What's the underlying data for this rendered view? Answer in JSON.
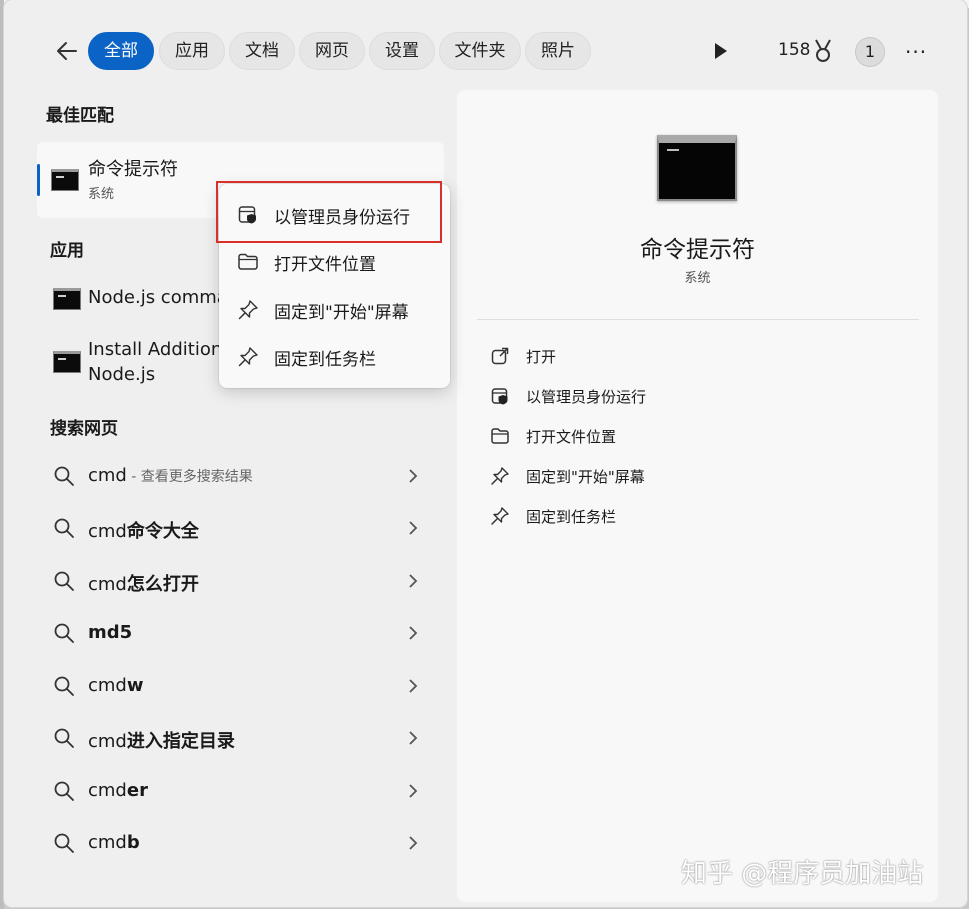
{
  "filters": {
    "back_label": "",
    "chips": [
      {
        "label": "全部",
        "active": true
      },
      {
        "label": "应用",
        "active": false
      },
      {
        "label": "文档",
        "active": false
      },
      {
        "label": "网页",
        "active": false
      },
      {
        "label": "设置",
        "active": false
      },
      {
        "label": "文件夹",
        "active": false
      },
      {
        "label": "照片",
        "active": false
      }
    ],
    "points": "158",
    "avatar_text": "1",
    "more_label": "···"
  },
  "best_match": {
    "section_title": "最佳匹配",
    "name": "命令提示符",
    "subtitle": "系统"
  },
  "apps": {
    "section_title": "应用",
    "items": [
      {
        "label": "Node.js comma"
      },
      {
        "label_line1": "Install Additiona",
        "label_line2": "Node.js"
      }
    ]
  },
  "web_search": {
    "section_title": "搜索网页",
    "items": [
      {
        "prefix": "cmd",
        "bold": "",
        "hint": " - 查看更多搜索结果"
      },
      {
        "prefix": "cmd",
        "bold": "命令大全",
        "hint": ""
      },
      {
        "prefix": "cmd",
        "bold": "怎么打开",
        "hint": ""
      },
      {
        "prefix": "",
        "bold": "md5",
        "hint": ""
      },
      {
        "prefix": "cmd",
        "bold": "w",
        "hint": ""
      },
      {
        "prefix": "cmd",
        "bold": "进入指定目录",
        "hint": ""
      },
      {
        "prefix": "cmd",
        "bold": "er",
        "hint": ""
      },
      {
        "prefix": "cmd",
        "bold": "b",
        "hint": ""
      }
    ]
  },
  "context_menu": {
    "items": [
      {
        "label": "以管理员身份运行",
        "icon": "shield-window-icon"
      },
      {
        "label": "打开文件位置",
        "icon": "folder-icon"
      },
      {
        "label": "固定到\"开始\"屏幕",
        "icon": "pin-icon"
      },
      {
        "label": "固定到任务栏",
        "icon": "pin-icon"
      }
    ],
    "highlight_color": "#d9302b"
  },
  "detail": {
    "title": "命令提示符",
    "subtitle": "系统",
    "actions": [
      {
        "label": "打开",
        "icon": "open-external-icon"
      },
      {
        "label": "以管理员身份运行",
        "icon": "shield-window-icon"
      },
      {
        "label": "打开文件位置",
        "icon": "folder-icon"
      },
      {
        "label": "固定到\"开始\"屏幕",
        "icon": "pin-icon"
      },
      {
        "label": "固定到任务栏",
        "icon": "pin-icon"
      }
    ]
  },
  "watermark": "知乎 @程序员加油站",
  "colors": {
    "accent": "#0b63c5",
    "highlight": "#d9302b"
  }
}
